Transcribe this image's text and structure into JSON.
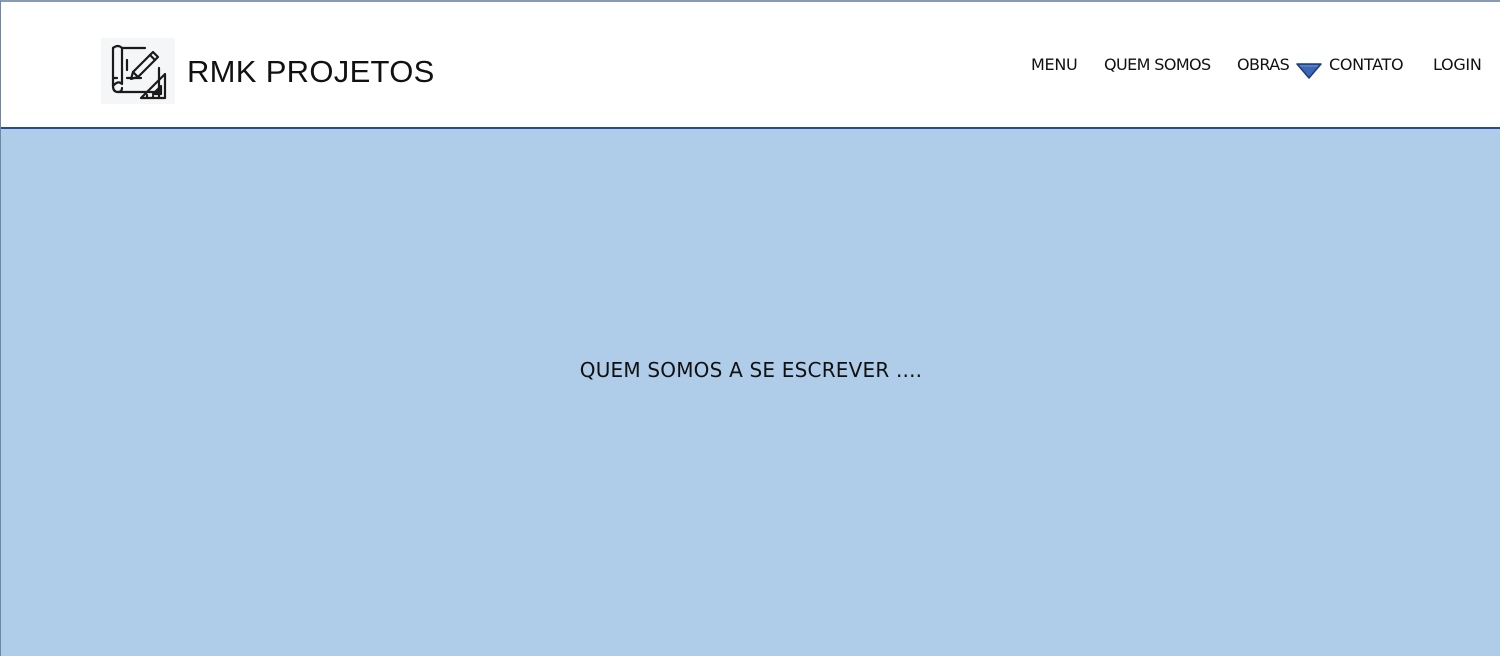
{
  "header": {
    "brand": "RMK PROJETOS",
    "logo_icon": "blueprint-drafting-icon"
  },
  "nav": {
    "items": [
      {
        "label": "MENU"
      },
      {
        "label": "QUEM SOMOS"
      },
      {
        "label": "OBRAS"
      },
      {
        "label": "CONTATO"
      },
      {
        "label": "LOGIN"
      }
    ],
    "dropdown_icon": "triangle-down-icon"
  },
  "main": {
    "text": "QUEM SOMOS A SE ESCREVER ...."
  },
  "colors": {
    "header_bg": "#ffffff",
    "header_border": "#2b4a8f",
    "main_bg": "#afcde9",
    "caret_fill": "#3b67b5",
    "caret_outline": "#1d3a7a"
  }
}
